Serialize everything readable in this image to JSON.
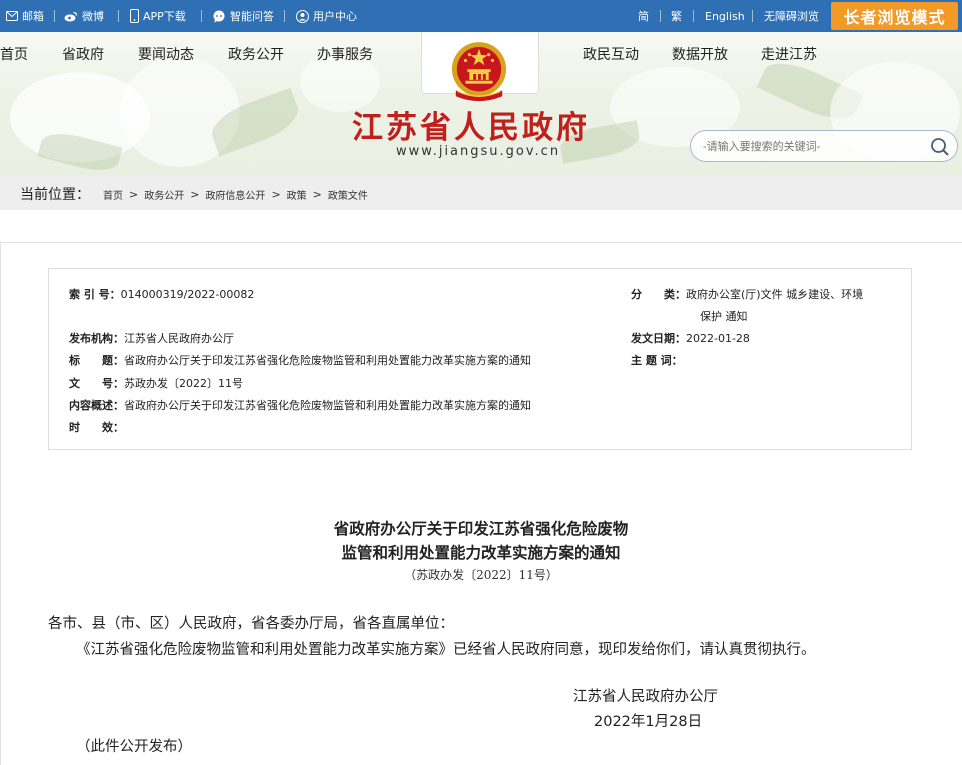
{
  "topbar": {
    "links": [
      {
        "label": "邮箱",
        "icon": "mail-icon"
      },
      {
        "label": "微博",
        "icon": "weibo-icon"
      },
      {
        "label": "APP下载",
        "icon": "phone-icon"
      },
      {
        "label": "智能问答",
        "icon": "chat-icon"
      },
      {
        "label": "用户中心",
        "icon": "user-icon"
      }
    ],
    "lang_simplified": "简",
    "lang_traditional": "繁",
    "lang_english": "English",
    "accessible": "无障碍浏览",
    "elder_mode": "长者浏览模式",
    "bar_color": "#2f6fb3",
    "elder_color": "#f39a26"
  },
  "nav": {
    "left": [
      "首页",
      "省政府",
      "要闻动态",
      "政务公开",
      "办事服务"
    ],
    "right": [
      "政民互动",
      "数据开放",
      "走进江苏"
    ]
  },
  "brand": {
    "title": "江苏省人民政府",
    "url": "www.jiangsu.gov.cn",
    "title_color": "#c0201c"
  },
  "search": {
    "placeholder": "-请输入要搜索的关键词-"
  },
  "breadcrumb": {
    "label": "当前位置：",
    "items": [
      "首页",
      "政务公开",
      "政府信息公开",
      "政策",
      "政策文件"
    ]
  },
  "meta": {
    "index_label": "索 引 号：",
    "index_value": "014000319/2022-00082",
    "category_label": "分　　类：",
    "category_value_line1": "政府办公室(厅)文件 城乡建设、环境",
    "category_value_line2": "保护 通知",
    "publisher_label": "发布机构：",
    "publisher_value": "江苏省人民政府办公厅",
    "date_label": "发文日期：",
    "date_value": "2022-01-28",
    "title_label": "标　　题：",
    "title_value": "省政府办公厅关于印发江苏省强化危险废物监管和利用处置能力改革实施方案的通知",
    "keywords_label": "主 题 词：",
    "keywords_value": "",
    "docno_label": "文　　号：",
    "docno_value": "苏政办发〔2022〕11号",
    "summary_label": "内容概述：",
    "summary_value": "省政府办公厅关于印发江苏省强化危险废物监管和利用处置能力改革实施方案的通知",
    "validity_label": "时　　效：",
    "validity_value": ""
  },
  "document": {
    "title_line1": "省政府办公厅关于印发江苏省强化危险废物",
    "title_line2": "监管和利用处置能力改革实施方案的通知",
    "doc_number": "（苏政办发〔2022〕11号）",
    "salutation": "各市、县（市、区）人民政府，省各委办厅局，省各直属单位：",
    "body": "《江苏省强化危险废物监管和利用处置能力改革实施方案》已经省人民政府同意，现印发给你们，请认真贯彻执行。",
    "signature": "江苏省人民政府办公厅",
    "sign_date": "2022年1月28日",
    "note": "（此件公开发布）"
  }
}
